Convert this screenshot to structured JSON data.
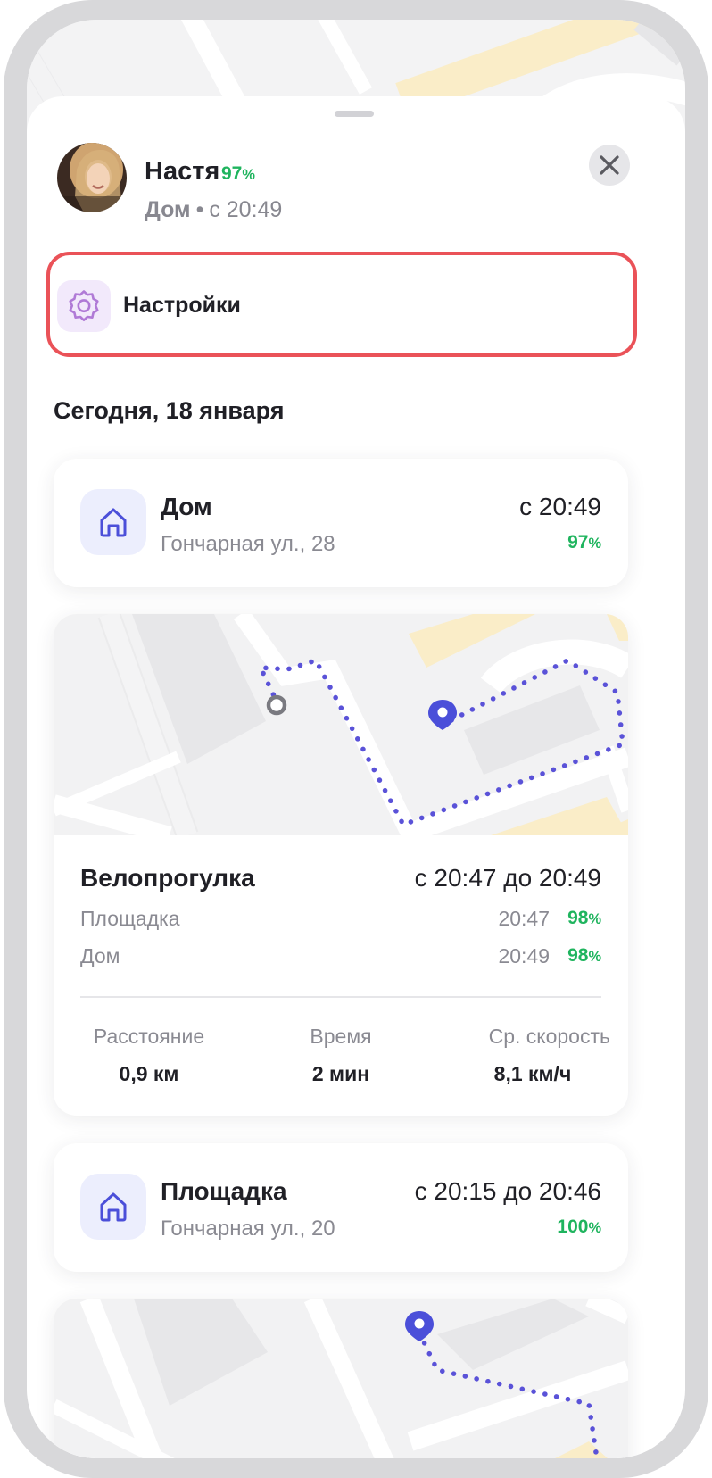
{
  "profile": {
    "name": "Настя",
    "battery": "97",
    "status_place": "Дом",
    "status_separator": "•",
    "status_since": "с 20:49"
  },
  "settings": {
    "label": "Настройки"
  },
  "timeline": {
    "date_header": "Сегодня, 18 января",
    "home_card": {
      "title": "Дом",
      "address": "Гончарная ул., 28",
      "time": "с 20:49",
      "battery": "97"
    },
    "trip_card": {
      "title": "Велопрогулка",
      "range": "с 20:47 до 20:49",
      "start": {
        "label": "Площадка",
        "time": "20:47",
        "battery": "98"
      },
      "end": {
        "label": "Дом",
        "time": "20:49",
        "battery": "98"
      },
      "stats": [
        {
          "label": "Расстояние",
          "value": "0,9 км"
        },
        {
          "label": "Время",
          "value": "2 мин"
        },
        {
          "label": "Ср. скорость",
          "value": "8,1 км/ч"
        }
      ]
    },
    "playground_card": {
      "title": "Площадка",
      "address": "Гончарная ул., 20",
      "time": "с 20:15 до 20:46",
      "battery": "100"
    }
  },
  "percent_sign": "%",
  "icons": {
    "close": "close-icon",
    "settings": "gear-icon",
    "home": "home-icon",
    "pin": "map-pin-icon"
  },
  "colors": {
    "accent_purple": "#5a52d8",
    "battery_green": "#1fb45e",
    "highlight_red": "#ea5258",
    "settings_tile": "#f2e9fb",
    "place_tile": "#eceefd"
  }
}
